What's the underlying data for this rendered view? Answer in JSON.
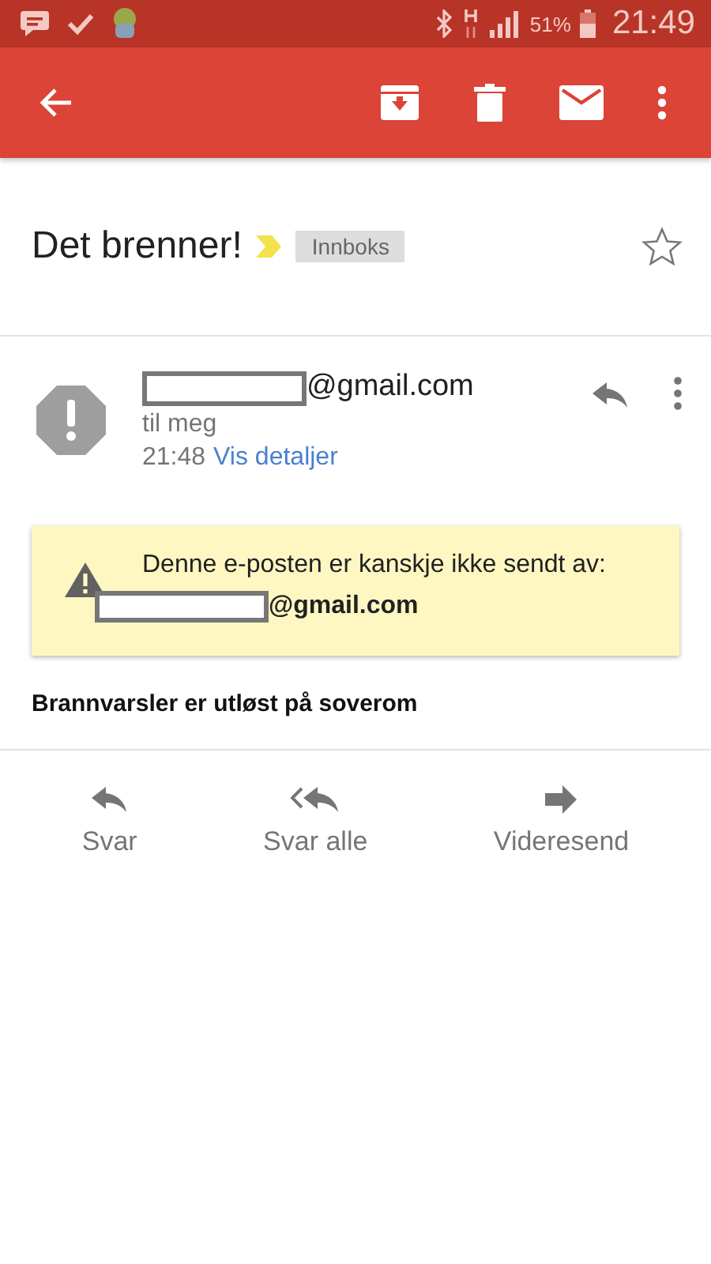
{
  "status_bar": {
    "battery": "51%",
    "time": "21:49"
  },
  "subject": {
    "title": "Det brenner!",
    "important": true,
    "label": "Innboks",
    "starred": false
  },
  "message": {
    "sender": "@gmail.com",
    "recipient": "til meg",
    "time": "21:48",
    "details_link": "Vis detaljer"
  },
  "warning": {
    "text": "Denne e-posten er kanskje ikke sendt av:",
    "sender": "@gmail.com"
  },
  "body": "Brannvarsler er utløst på soverom",
  "actions": [
    {
      "kind": "reply",
      "label": "Svar"
    },
    {
      "kind": "reply_all",
      "label": "Svar alle"
    },
    {
      "kind": "forward",
      "label": "Videresend"
    }
  ]
}
